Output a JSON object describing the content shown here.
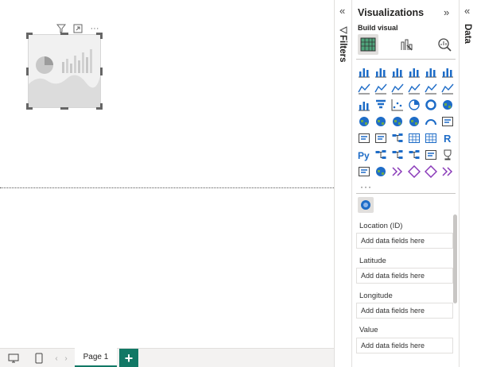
{
  "canvas": {
    "visual_header_icons": [
      "filter-icon",
      "focus-mode-icon",
      "more-options-icon"
    ],
    "more_glyph": "···"
  },
  "bottom_bar": {
    "page_tab_label": "Page 1",
    "add_page_label": "+"
  },
  "filters_pane": {
    "title": "Filters",
    "collapse_glyph": "«"
  },
  "viz_pane": {
    "title": "Visualizations",
    "collapse_glyph": "»",
    "build_visual_label": "Build visual",
    "more_glyph": "···",
    "wells": [
      {
        "label": "Location (ID)",
        "placeholder": "Add data fields here"
      },
      {
        "label": "Latitude",
        "placeholder": "Add data fields here"
      },
      {
        "label": "Longitude",
        "placeholder": "Add data fields here"
      },
      {
        "label": "Value",
        "placeholder": "Add data fields here"
      }
    ]
  },
  "data_pane": {
    "title": "Data",
    "collapse_glyph": "«"
  },
  "colors": {
    "accent": "#117865",
    "viz_blue": "#1e6cc7",
    "viz_orange": "#e69a2e"
  }
}
